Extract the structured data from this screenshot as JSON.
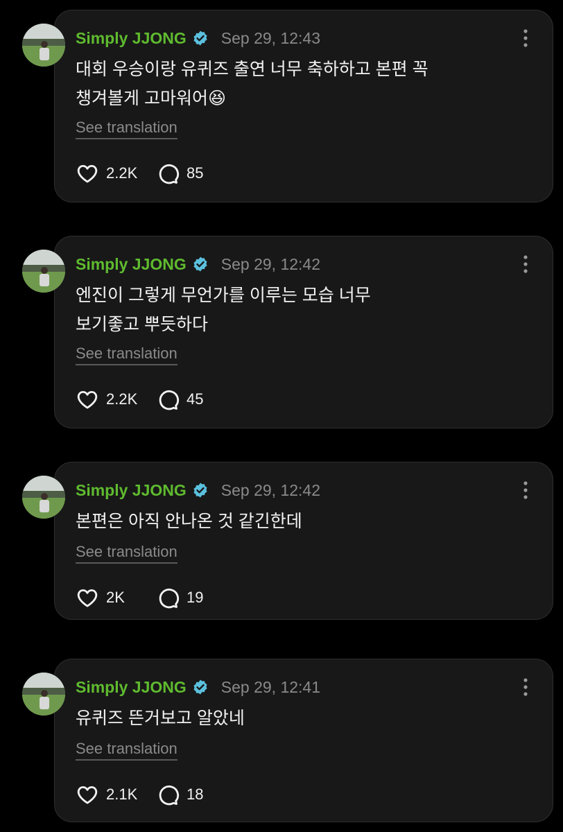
{
  "author": "Simply JJONG",
  "translate_label": "See translation",
  "colors": {
    "name": "#5fbb2f",
    "verified": "#5bc0de",
    "background": "#000000",
    "card": "#181818"
  },
  "posts": [
    {
      "time": "Sep 29, 12:43",
      "text": "대회 우승이랑 유퀴즈 출연 너무 축하하고 본편 꼭\n챙겨볼게 고마워어😆",
      "likes": "2.2K",
      "replies": "85"
    },
    {
      "time": "Sep 29, 12:42",
      "text": "엔진이 그렇게 무언가를 이루는 모습 너무\n보기좋고 뿌듯하다",
      "likes": "2.2K",
      "replies": "45"
    },
    {
      "time": "Sep 29, 12:42",
      "text": "본편은 아직 안나온 것 같긴한데",
      "likes": "2K",
      "replies": "19"
    },
    {
      "time": "Sep 29, 12:41",
      "text": "유퀴즈 뜬거보고 알았네",
      "likes": "2.1K",
      "replies": "18"
    }
  ]
}
